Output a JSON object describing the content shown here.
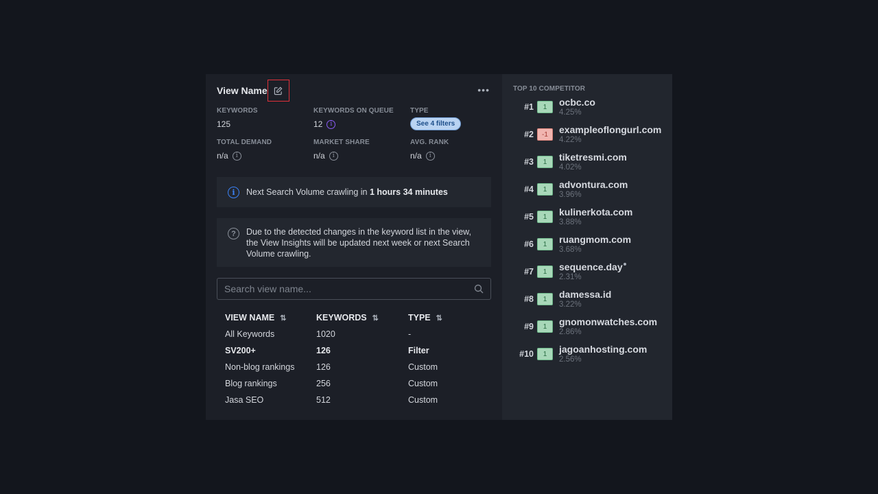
{
  "header": {
    "title": "View Name"
  },
  "stats": [
    {
      "label": "KEYWORDS",
      "value": "125"
    },
    {
      "label": "KEYWORDS ON QUEUE",
      "value": "12"
    },
    {
      "label": "TYPE",
      "value": "See 4 filters"
    },
    {
      "label": "TOTAL DEMAND",
      "value": "n/a"
    },
    {
      "label": "MARKET SHARE",
      "value": "n/a"
    },
    {
      "label": "AVG. RANK",
      "value": "n/a"
    }
  ],
  "notice": {
    "text": "Next Search Volume crawling in ",
    "bold": "1 hours 34 minutes"
  },
  "notice2": {
    "text": "Due to the detected changes in the keyword list in the view, the View Insights will be updated next week or next Search Volume crawling."
  },
  "search": {
    "placeholder": "Search view name..."
  },
  "table": {
    "headers": [
      "VIEW NAME",
      "KEYWORDS",
      "TYPE"
    ],
    "rows": [
      [
        "All Keywords",
        "1020",
        "-"
      ],
      [
        "SV200+",
        "126",
        "Filter"
      ],
      [
        "Non-blog rankings",
        "126",
        "Custom"
      ],
      [
        "Blog rankings",
        "256",
        "Custom"
      ],
      [
        "Jasa SEO",
        "512",
        "Custom"
      ]
    ]
  },
  "competitors": {
    "title": "TOP 10 COMPETITOR",
    "items": [
      {
        "rank": "#1",
        "delta": "1",
        "trend": "up",
        "domain": "ocbc.co",
        "share": "4.25%"
      },
      {
        "rank": "#2",
        "delta": "-1",
        "trend": "down",
        "domain": "exampleoflongurl.com",
        "share": "4.22%"
      },
      {
        "rank": "#3",
        "delta": "1",
        "trend": "up",
        "domain": "tiketresmi.com",
        "share": "4.02%"
      },
      {
        "rank": "#4",
        "delta": "1",
        "trend": "up",
        "domain": "advontura.com",
        "share": "3.96%"
      },
      {
        "rank": "#5",
        "delta": "1",
        "trend": "up",
        "domain": "kulinerkota.com",
        "share": "3.88%"
      },
      {
        "rank": "#6",
        "delta": "1",
        "trend": "up",
        "domain": "ruangmom.com",
        "share": "3.68%"
      },
      {
        "rank": "#7",
        "delta": "1",
        "trend": "up",
        "domain": "sequence.day",
        "share": "2.31%"
      },
      {
        "rank": "#8",
        "delta": "1",
        "trend": "up",
        "domain": "damessa.id",
        "share": "3.22%"
      },
      {
        "rank": "#9",
        "delta": "1",
        "trend": "up",
        "domain": "gnomonwatches.com",
        "share": "2.86%"
      },
      {
        "rank": "#10",
        "delta": "1",
        "trend": "up",
        "domain": "jagoanhosting.com",
        "share": "2.56%"
      }
    ]
  },
  "colors": {
    "background": "#13161d",
    "panel": "#1c1f27",
    "sidebar": "#22262e",
    "highlight_border": "#e0313a",
    "info_blue": "#3b82f6",
    "info_purple": "#8b5cf6",
    "delta_up": "#a8d8b9",
    "delta_down": "#f1b5b0"
  },
  "icons": {
    "edit": "edit-icon",
    "more": "more-horizontal-icon",
    "info": "info-icon",
    "help": "help-icon",
    "search": "search-icon",
    "sort": "sort-icon"
  }
}
